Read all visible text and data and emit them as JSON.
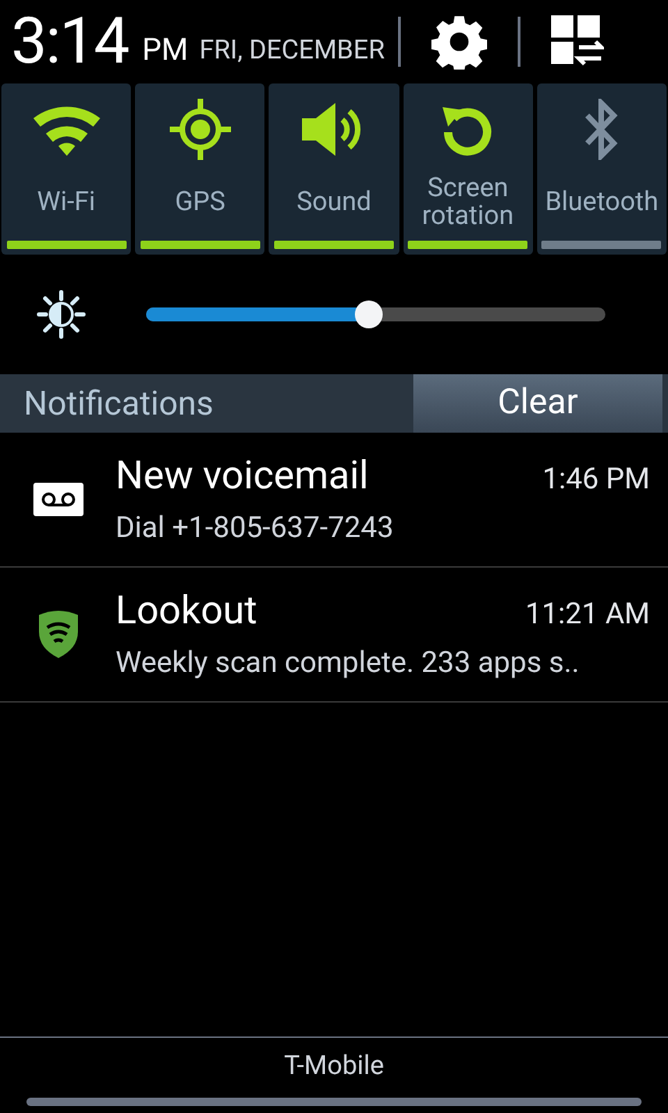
{
  "status": {
    "time": "3:14",
    "ampm": "PM",
    "date": "FRI, DECEMBER"
  },
  "toggles": [
    {
      "label": "Wi-Fi",
      "kind": "wifi",
      "on": true
    },
    {
      "label": "GPS",
      "kind": "gps",
      "on": true
    },
    {
      "label": "Sound",
      "kind": "sound",
      "on": true
    },
    {
      "label": "Screen rotation",
      "kind": "rotation",
      "on": true
    },
    {
      "label": "Bluetooth",
      "kind": "bluetooth",
      "on": false
    }
  ],
  "brightness": {
    "level": 0.485
  },
  "notifications": {
    "header": "Notifications",
    "clear": "Clear",
    "items": [
      {
        "kind": "voicemail",
        "title": "New voicemail",
        "time": "1:46 PM",
        "text": "Dial +1-805-637-7243"
      },
      {
        "kind": "shield",
        "title": "Lookout",
        "time": "11:21 AM",
        "text": "Weekly scan complete. 233 apps s.."
      }
    ]
  },
  "carrier": "T-Mobile"
}
